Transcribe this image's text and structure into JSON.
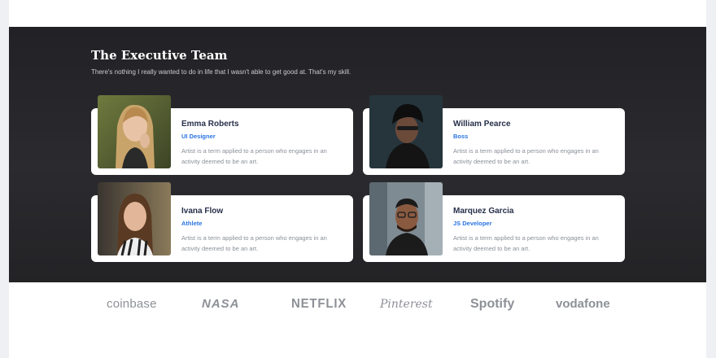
{
  "section": {
    "title": "The Executive Team",
    "subtitle": "There's nothing I really wanted to do in life that I wasn't able to get good at. That's my skill."
  },
  "team": [
    {
      "name": "Emma Roberts",
      "role": "UI Designer",
      "desc_line1": "Artist is a term applied to a person who engages in an",
      "desc_line2": "activity deemed to be an art."
    },
    {
      "name": "William Pearce",
      "role": "Boss",
      "desc_line1": "Artist is a term applied to a person who engages in an",
      "desc_line2": "activity deemed to be an art."
    },
    {
      "name": "Ivana Flow",
      "role": "Athlete",
      "desc_line1": "Artist is a term applied to a person who engages in an",
      "desc_line2": "activity deemed to be an art."
    },
    {
      "name": "Marquez Garcia",
      "role": "JS Developer",
      "desc_line1": "Artist is a term applied to a person who engages in an",
      "desc_line2": "activity deemed to be an art."
    }
  ],
  "logos": [
    "coinbase",
    "NASA",
    "NETFLIX",
    "Pinterest",
    "Spotify",
    "vodafone"
  ],
  "colors": {
    "section_bg": "#262629",
    "card_bg": "#ffffff",
    "name": "#27304a",
    "role_accent": "#2a74e2",
    "desc": "#8a8f99",
    "logo_gray": "#8d9096"
  }
}
